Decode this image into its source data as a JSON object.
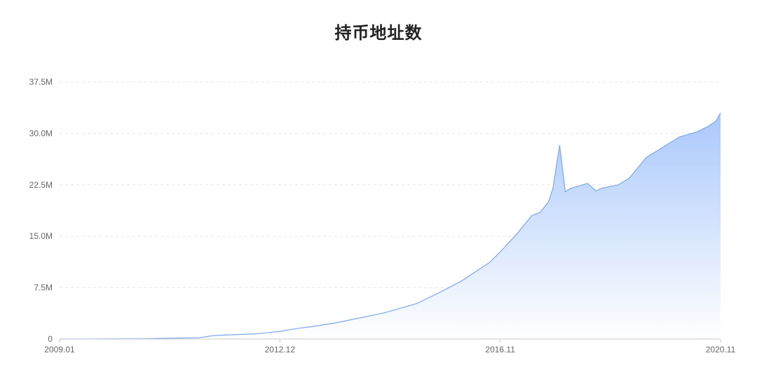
{
  "chart_data": {
    "type": "area",
    "title": "持币地址数",
    "xlabel": "",
    "ylabel": "",
    "x_ticks": [
      "2009.01",
      "2012.12",
      "2016.11",
      "2020.11"
    ],
    "y_ticks": [
      "0",
      "7.5M",
      "15.0M",
      "22.5M",
      "30.0M",
      "37.5M"
    ],
    "ylim": [
      0,
      37.5
    ],
    "y_unit": "M",
    "xlim": [
      2009.0,
      2020.83
    ],
    "grid": true,
    "series": [
      {
        "x": [
          2009.0,
          2010.5,
          2011.5,
          2011.75,
          2012.0,
          2012.5,
          2012.92,
          2013.3,
          2013.5,
          2013.9,
          2014.2,
          2014.8,
          2015.4,
          2015.8,
          2016.2,
          2016.7,
          2016.92,
          2017.2,
          2017.45,
          2017.6,
          2017.75,
          2017.83,
          2017.95,
          2018.05,
          2018.15,
          2018.45,
          2018.6,
          2018.7,
          2019.0,
          2019.2,
          2019.5,
          2019.8,
          2020.1,
          2020.4,
          2020.6,
          2020.75,
          2020.83
        ],
        "y": [
          0.0,
          0.05,
          0.2,
          0.5,
          0.6,
          0.75,
          1.1,
          1.6,
          1.8,
          2.3,
          2.8,
          3.8,
          5.2,
          6.8,
          8.5,
          11.2,
          13.0,
          15.5,
          18.0,
          18.5,
          20.0,
          22.0,
          28.3,
          21.5,
          22.0,
          22.7,
          21.6,
          22.0,
          22.5,
          23.5,
          26.5,
          28.0,
          29.5,
          30.2,
          31.0,
          31.8,
          33.0
        ]
      }
    ],
    "colors": {
      "line": "#7ba7f2",
      "fill_top": "#a9c8fb",
      "fill_bottom": "#ffffff",
      "grid": "#e5e5e5",
      "axis": "#cccccc",
      "text": "#666666"
    }
  }
}
